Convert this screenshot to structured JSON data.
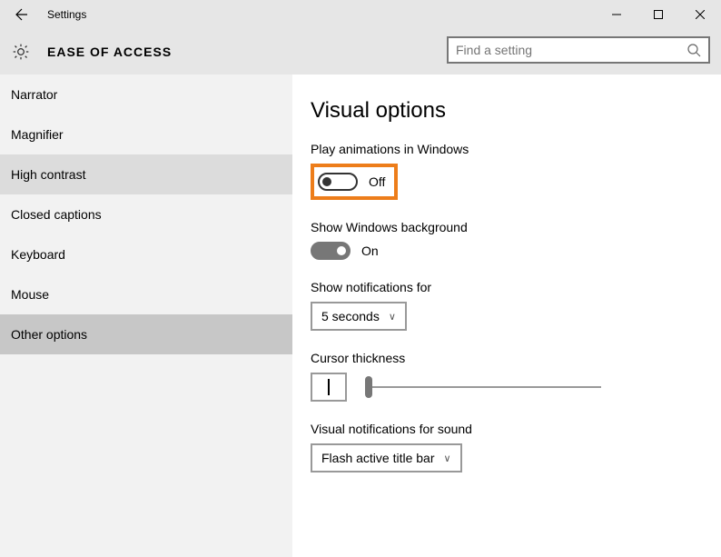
{
  "window": {
    "title": "Settings"
  },
  "header": {
    "title": "EASE OF ACCESS",
    "search_placeholder": "Find a setting"
  },
  "sidebar": {
    "items": [
      {
        "label": "Narrator"
      },
      {
        "label": "Magnifier"
      },
      {
        "label": "High contrast"
      },
      {
        "label": "Closed captions"
      },
      {
        "label": "Keyboard"
      },
      {
        "label": "Mouse"
      },
      {
        "label": "Other options"
      }
    ]
  },
  "main": {
    "section_title": "Visual options",
    "play_animations": {
      "label": "Play animations in Windows",
      "state": "Off"
    },
    "show_background": {
      "label": "Show Windows background",
      "state": "On"
    },
    "notifications": {
      "label": "Show notifications for",
      "value": "5 seconds"
    },
    "cursor": {
      "label": "Cursor thickness"
    },
    "visual_notifications": {
      "label": "Visual notifications for sound",
      "value": "Flash active title bar"
    }
  }
}
